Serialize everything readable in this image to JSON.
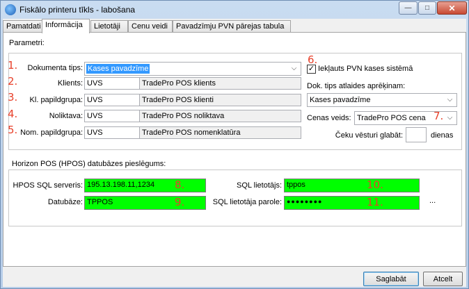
{
  "window": {
    "title": "Fiskālo printeru tīkls - labošana",
    "btn_min": "—",
    "btn_max": "□",
    "btn_close": "✕"
  },
  "tabs": [
    "Pamatdati",
    "Informācija",
    "Lietotāji",
    "Cenu veidi",
    "Pavadzīmju PVN pārejas tabula"
  ],
  "active_tab": "Informācija",
  "params": {
    "group_label": "Parametri:",
    "doc_type": {
      "marker": "1.",
      "label": "Dokumenta tips:",
      "value": "Kases pavadzīme"
    },
    "client": {
      "marker": "2.",
      "label": "Klients:",
      "code": "UVS",
      "name": "TradePro POS klients"
    },
    "client_group": {
      "marker": "3.",
      "label": "Kl. papildgrupa:",
      "code": "UVS",
      "name": "TradePro POS klienti"
    },
    "warehouse": {
      "marker": "4.",
      "label": "Noliktava:",
      "code": "UVS",
      "name": "TradePro POS noliktava"
    },
    "nom_group": {
      "marker": "5.",
      "label": "Nom. papildgrupa:",
      "code": "UVS",
      "name": "TradePro POS nomenklatūra"
    },
    "vat_included": {
      "marker": "6.",
      "label": "Iekļauts PVN kases sistēmā",
      "checked": true
    },
    "discount_doc_label": "Dok. tips atlaides aprēķinam:",
    "discount_doc_value": "Kases pavadzīme",
    "price_type": {
      "marker": "7.",
      "label": "Cenas veids:",
      "value": "TradePro POS cena"
    },
    "receipt_history": {
      "label": "Čeku vēsturi glabāt:",
      "value": "",
      "unit": "dienas"
    }
  },
  "hpos": {
    "group_label": "Horizon POS (HPOS) datubāzes pieslēgums:",
    "server": {
      "marker": "8.",
      "label": "HPOS SQL serveris:",
      "value": "195.13.198.11,1234"
    },
    "database": {
      "marker": "9.",
      "label": "Datubāze:",
      "value": "TPPOS"
    },
    "sql_user": {
      "marker": "10.",
      "label": "SQL lietotājs:",
      "value": "tppos"
    },
    "sql_password": {
      "marker": "11.",
      "label": "SQL lietotāja parole:",
      "value": "●●●●●●●●"
    },
    "more_button": "..."
  },
  "footer": {
    "save": "Saglabāt",
    "cancel": "Atcelt"
  },
  "colors": {
    "highlight_green": "#00ff00",
    "marker_red": "#e8402a",
    "selection_blue": "#3399ff"
  }
}
